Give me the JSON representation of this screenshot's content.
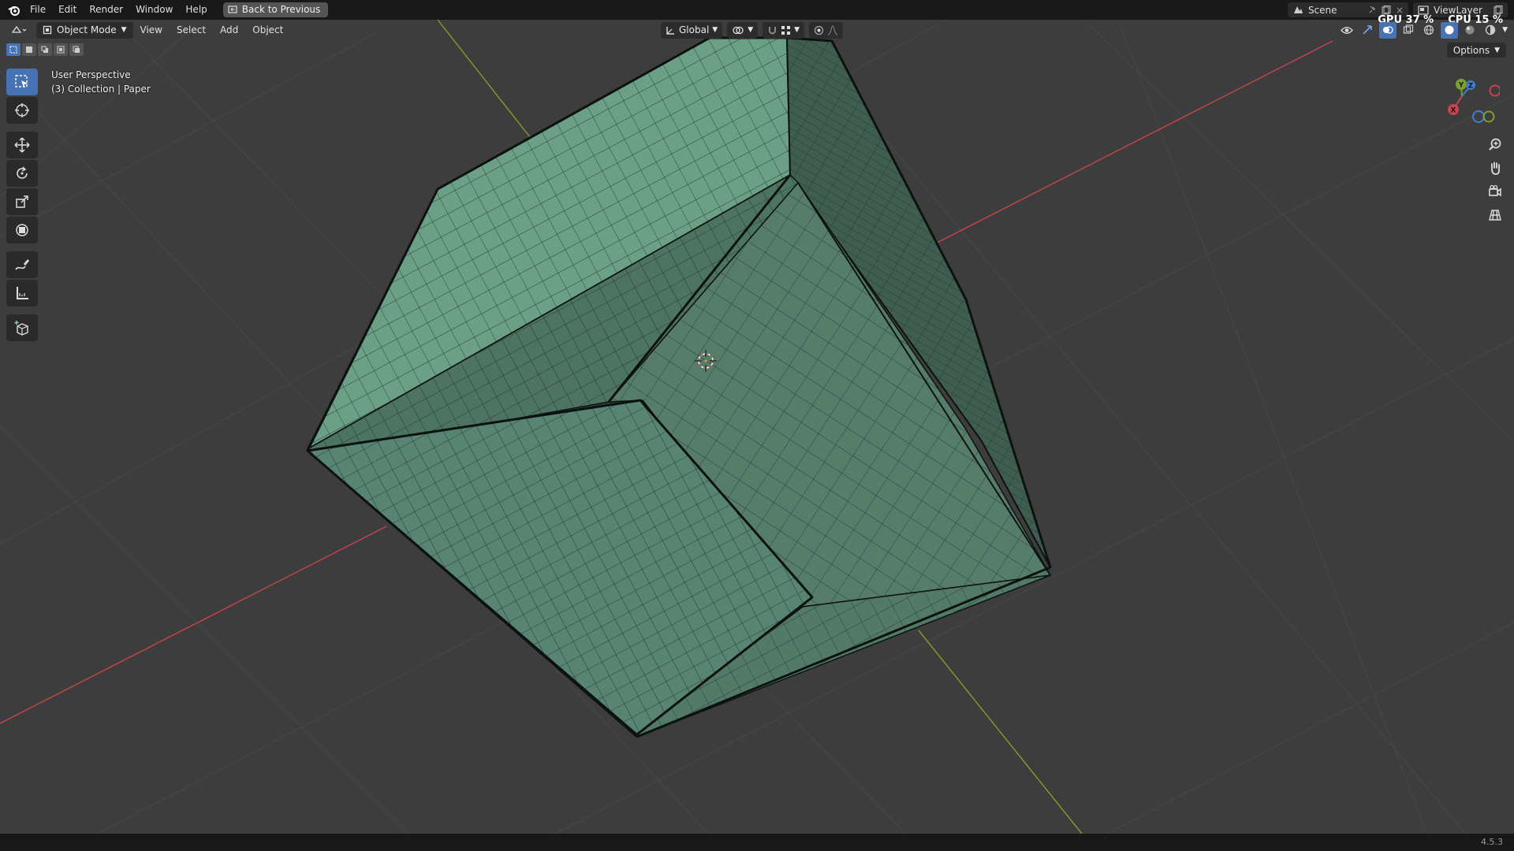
{
  "topbar": {
    "menus": [
      "File",
      "Edit",
      "Render",
      "Window",
      "Help"
    ],
    "back_label": "Back to Previous",
    "scene_name": "Scene",
    "view_layer": "ViewLayer",
    "gpu_stat": "GPU 37 %",
    "cpu_stat": "CPU 15 %"
  },
  "viewport_header": {
    "mode": "Object Mode",
    "menus": [
      "View",
      "Select",
      "Add",
      "Object"
    ],
    "transform_orientation": "Global"
  },
  "options_label": "Options",
  "viewport_info": {
    "view_name": "User Perspective",
    "collection": "(3) Collection | Paper"
  },
  "gizmo_axes": {
    "x": "X",
    "y": "Y",
    "z": "Z"
  },
  "status": {
    "version": "4.5.3"
  },
  "colors": {
    "accent": "#4772b3",
    "mesh": "#5b8a72",
    "axis_x": "#c8454f",
    "axis_y": "#7ea02e",
    "background": "#3d3d3d"
  },
  "tools": [
    "select-box-icon",
    "cursor-icon",
    "move-icon",
    "rotate-icon",
    "scale-icon",
    "transform-icon",
    "annotate-icon",
    "measure-icon",
    "add-cube-icon"
  ]
}
